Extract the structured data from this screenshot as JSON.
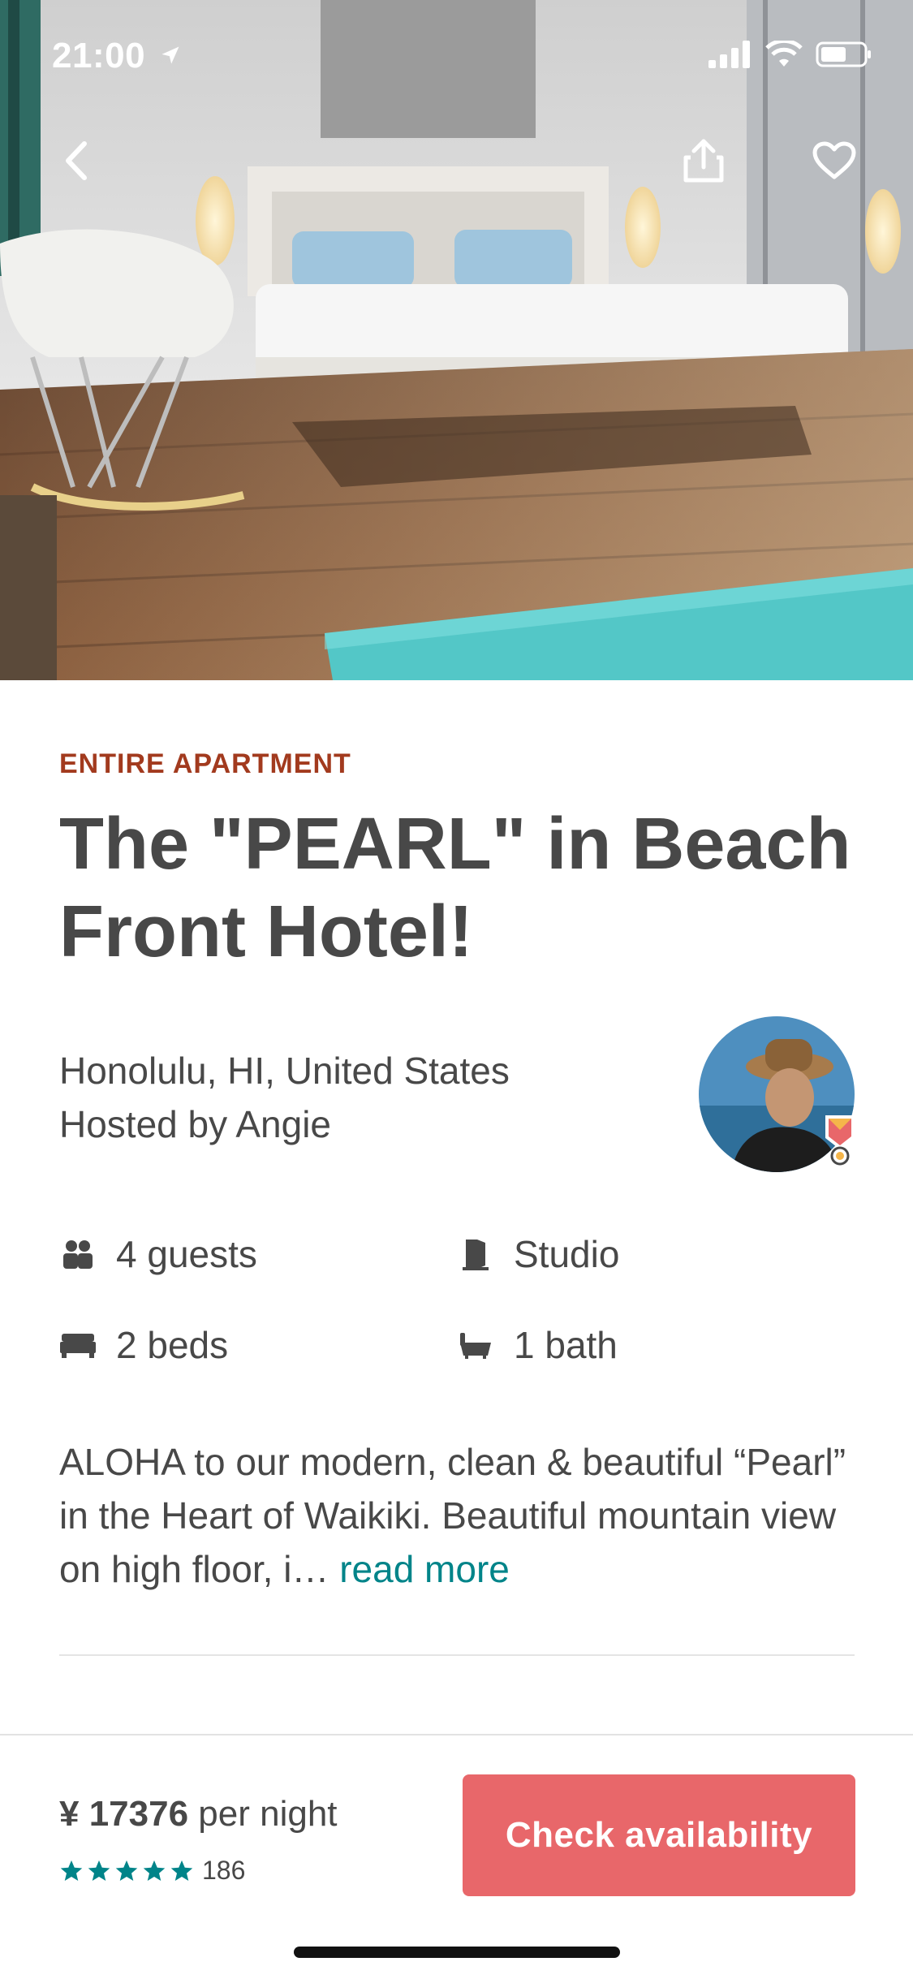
{
  "status": {
    "time": "21:00"
  },
  "hero": {
    "alt": "Bedroom with white bed, rocking chair and wooden floor"
  },
  "listing": {
    "type": "ENTIRE APARTMENT",
    "title": "The \"PEARL\" in Beach Front Hotel!",
    "location": "Honolulu, HI, United States",
    "host": "Hosted by Angie"
  },
  "facts": [
    {
      "icon": "guests-icon",
      "label": "4 guests"
    },
    {
      "icon": "door-icon",
      "label": "Studio"
    },
    {
      "icon": "bed-icon",
      "label": "2 beds"
    },
    {
      "icon": "bathtub-icon",
      "label": "1 bath"
    }
  ],
  "description": {
    "text": "ALOHA to our modern, clean & beautiful “Pearl” in the Heart of Waikiki. Beautiful mountain view on high floor, i…",
    "read_more": "read more"
  },
  "booking": {
    "price": "¥ 17376",
    "per": "per night",
    "rating_stars": 5,
    "review_count": "186",
    "cta": "Check availability"
  },
  "colors": {
    "kicker": "#A23A1E",
    "accent": "#E8676A",
    "teal": "#008489",
    "star": "#008489"
  }
}
